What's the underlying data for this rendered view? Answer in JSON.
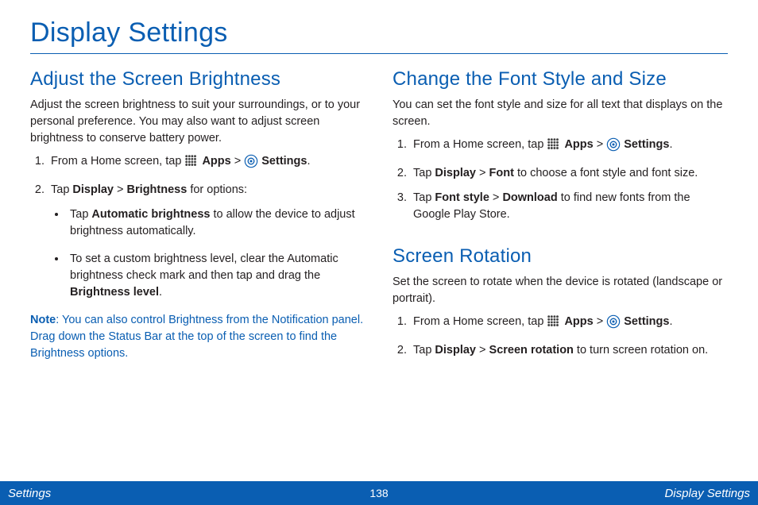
{
  "page": {
    "title": "Display Settings"
  },
  "left": {
    "section1": {
      "heading": "Adjust the Screen Brightness",
      "intro": "Adjust the screen brightness to suit your surroundings, or to your personal preference. You may also want to adjust screen brightness to conserve battery power.",
      "step1_pre": "From a Home screen, tap ",
      "apps": "Apps",
      "gt": " > ",
      "settings": "Settings",
      "period": ".",
      "step2_pre": "Tap ",
      "display": "Display",
      "brightness": "Brightness",
      "step2_post": " for options:",
      "bullet1_pre": "Tap ",
      "bullet1_bold": "Automatic brightness",
      "bullet1_post": " to allow the device to adjust brightness automatically.",
      "bullet2_pre": "To set a custom brightness level, clear the Automatic brightness check mark and then tap and drag the ",
      "bullet2_bold": "Brightness level",
      "bullet2_post": ".",
      "note_label": "Note",
      "note_body": ": You can also control Brightness from the Notification panel. Drag down the Status Bar at the top of the screen to find the Brightness options."
    }
  },
  "right": {
    "section1": {
      "heading": "Change the Font Style and Size",
      "intro": "You can set the font style and size for all text that displays on the screen.",
      "step1_pre": "From a Home screen, tap ",
      "apps": "Apps",
      "gt": " > ",
      "settings": "Settings",
      "period": ".",
      "step2_pre": "Tap ",
      "display": "Display",
      "font": "Font",
      "step2_post": " to choose a font style and font size.",
      "step3_pre": "Tap ",
      "fontstyle": "Font style",
      "download": "Download",
      "step3_post": " to find new fonts from the Google Play Store."
    },
    "section2": {
      "heading": "Screen Rotation",
      "intro": "Set the screen to rotate when the device is rotated (landscape or portrait).",
      "step1_pre": "From a Home screen, tap ",
      "apps": "Apps",
      "gt": " > ",
      "settings": "Settings",
      "period": ".",
      "step2_pre": "Tap ",
      "display": "Display",
      "rotation": "Screen rotation",
      "step2_post": " to turn screen rotation on."
    }
  },
  "footer": {
    "left": "Settings",
    "page": "138",
    "right": "Display Settings"
  }
}
